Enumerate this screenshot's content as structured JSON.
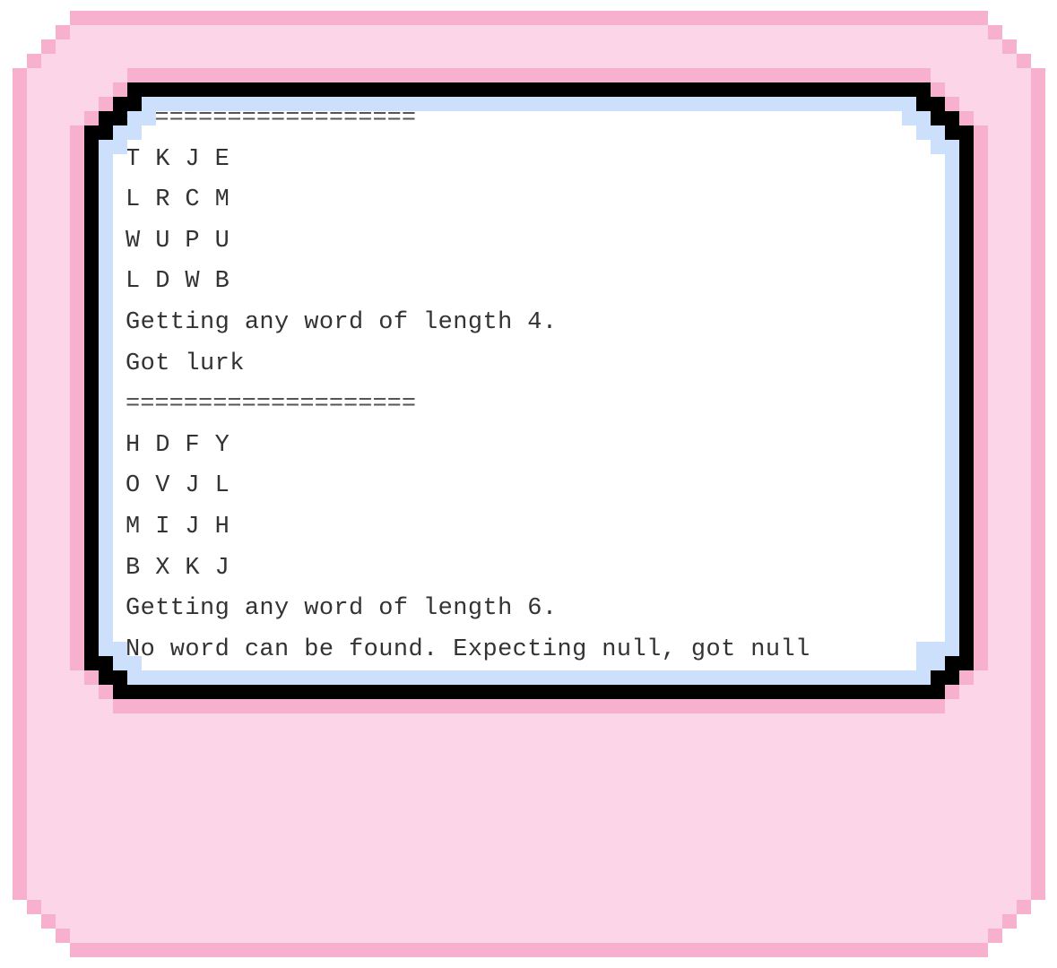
{
  "colors": {
    "frame_outline": "#f7b0cd",
    "frame_fill": "#fdd5e8",
    "screen_bezel": "#000000",
    "screen_edge": "#cce0fb",
    "screen_fill": "#ffffff",
    "text": "#333333"
  },
  "console": {
    "lines": [
      "====================",
      "T K J E",
      "L R C M",
      "W U P U",
      "L D W B",
      "Getting any word of length 4.",
      "Got lurk",
      "====================",
      "H D F Y",
      "O V J L",
      "M I J H",
      "B X K J",
      "Getting any word of length 6.",
      "No word can be found. Expecting null, got null"
    ]
  }
}
